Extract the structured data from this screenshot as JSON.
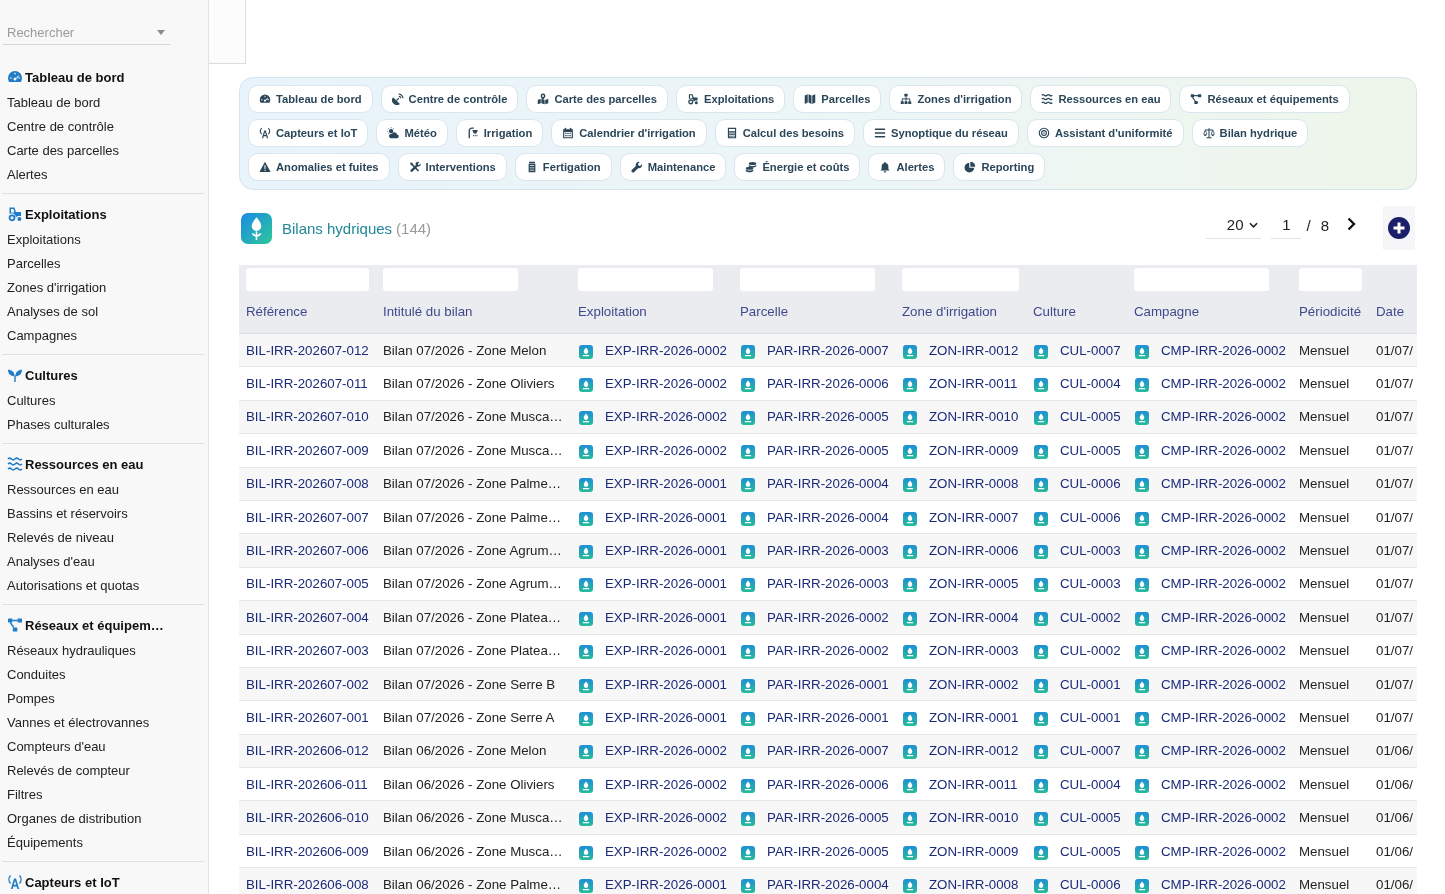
{
  "sidebar": {
    "search": {
      "placeholder": "Rechercher"
    },
    "sections": [
      {
        "title": "Tableau de bord",
        "items": [
          "Tableau de bord",
          "Centre de contrôle",
          "Carte des parcelles",
          "Alertes"
        ]
      },
      {
        "title": "Exploitations",
        "items": [
          "Exploitations",
          "Parcelles",
          "Zones d'irrigation",
          "Analyses de sol",
          "Campagnes"
        ]
      },
      {
        "title": "Cultures",
        "items": [
          "Cultures",
          "Phases culturales"
        ]
      },
      {
        "title": "Ressources en eau",
        "items": [
          "Ressources en eau",
          "Bassins et réservoirs",
          "Relevés de niveau",
          "Analyses d'eau",
          "Autorisations et quotas"
        ]
      },
      {
        "title": "Réseaux et équipem…",
        "items": [
          "Réseaux hydrauliques",
          "Conduites",
          "Pompes",
          "Vannes et électrovannes",
          "Compteurs d'eau",
          "Relevés de compteur",
          "Filtres",
          "Organes de distribution",
          "Équipements"
        ]
      },
      {
        "title": "Capteurs et IoT"
      }
    ]
  },
  "nav": {
    "rows": [
      [
        "Tableau de bord",
        "Centre de contrôle",
        "Carte des parcelles",
        "Exploitations",
        "Parcelles",
        "Zones d'irrigation",
        "Ressources en eau",
        "Réseaux et équipements"
      ],
      [
        "Capteurs et IoT",
        "Météo",
        "Irrigation",
        "Calendrier d'irrigation",
        "Calcul des besoins",
        "Synoptique du réseau",
        "Assistant d'uniformité",
        "Bilan hydrique"
      ],
      [
        "Anomalies et fuites",
        "Interventions",
        "Fertigation",
        "Maintenance",
        "Énergie et coûts",
        "Alertes",
        "Reporting"
      ]
    ]
  },
  "list": {
    "title": "Bilans hydriques",
    "count": "(144)",
    "page_size": "20",
    "page": "1",
    "page_separator": "/",
    "page_count": "8"
  },
  "table": {
    "columns": [
      {
        "label": "Référence",
        "kind": "ref",
        "filter_field": true
      },
      {
        "label": "Intitulé du bilan",
        "kind": "text",
        "filter_field": true
      },
      {
        "label": "Exploitation",
        "kind": "link",
        "filter_field": true
      },
      {
        "label": "Parcelle",
        "kind": "link",
        "filter_field": true
      },
      {
        "label": "Zone d'irrigation",
        "kind": "link",
        "filter_field": true
      },
      {
        "label": "Culture",
        "kind": "link",
        "filter_field": false
      },
      {
        "label": "Campagne",
        "kind": "link",
        "filter_field": true
      },
      {
        "label": "Périodicité",
        "kind": "text",
        "filter_field": true
      },
      {
        "label": "Date",
        "kind": "text",
        "filter_field": false
      }
    ],
    "rows": [
      [
        "BIL-IRR-202607-012",
        "Bilan 07/2026 - Zone Melon",
        "EXP-IRR-2026-0002",
        "PAR-IRR-2026-0007",
        "ZON-IRR-0012",
        "CUL-0007",
        "CMP-IRR-2026-0002",
        "Mensuel",
        "01/07/"
      ],
      [
        "BIL-IRR-202607-011",
        "Bilan 07/2026 - Zone Oliviers",
        "EXP-IRR-2026-0002",
        "PAR-IRR-2026-0006",
        "ZON-IRR-0011",
        "CUL-0004",
        "CMP-IRR-2026-0002",
        "Mensuel",
        "01/07/"
      ],
      [
        "BIL-IRR-202607-010",
        "Bilan 07/2026 - Zone Musca…",
        "EXP-IRR-2026-0002",
        "PAR-IRR-2026-0005",
        "ZON-IRR-0010",
        "CUL-0005",
        "CMP-IRR-2026-0002",
        "Mensuel",
        "01/07/"
      ],
      [
        "BIL-IRR-202607-009",
        "Bilan 07/2026 - Zone Musca…",
        "EXP-IRR-2026-0002",
        "PAR-IRR-2026-0005",
        "ZON-IRR-0009",
        "CUL-0005",
        "CMP-IRR-2026-0002",
        "Mensuel",
        "01/07/"
      ],
      [
        "BIL-IRR-202607-008",
        "Bilan 07/2026 - Zone Palme…",
        "EXP-IRR-2026-0001",
        "PAR-IRR-2026-0004",
        "ZON-IRR-0008",
        "CUL-0006",
        "CMP-IRR-2026-0002",
        "Mensuel",
        "01/07/"
      ],
      [
        "BIL-IRR-202607-007",
        "Bilan 07/2026 - Zone Palme…",
        "EXP-IRR-2026-0001",
        "PAR-IRR-2026-0004",
        "ZON-IRR-0007",
        "CUL-0006",
        "CMP-IRR-2026-0002",
        "Mensuel",
        "01/07/"
      ],
      [
        "BIL-IRR-202607-006",
        "Bilan 07/2026 - Zone Agrum…",
        "EXP-IRR-2026-0001",
        "PAR-IRR-2026-0003",
        "ZON-IRR-0006",
        "CUL-0003",
        "CMP-IRR-2026-0002",
        "Mensuel",
        "01/07/"
      ],
      [
        "BIL-IRR-202607-005",
        "Bilan 07/2026 - Zone Agrum…",
        "EXP-IRR-2026-0001",
        "PAR-IRR-2026-0003",
        "ZON-IRR-0005",
        "CUL-0003",
        "CMP-IRR-2026-0002",
        "Mensuel",
        "01/07/"
      ],
      [
        "BIL-IRR-202607-004",
        "Bilan 07/2026 - Zone Platea…",
        "EXP-IRR-2026-0001",
        "PAR-IRR-2026-0002",
        "ZON-IRR-0004",
        "CUL-0002",
        "CMP-IRR-2026-0002",
        "Mensuel",
        "01/07/"
      ],
      [
        "BIL-IRR-202607-003",
        "Bilan 07/2026 - Zone Platea…",
        "EXP-IRR-2026-0001",
        "PAR-IRR-2026-0002",
        "ZON-IRR-0003",
        "CUL-0002",
        "CMP-IRR-2026-0002",
        "Mensuel",
        "01/07/"
      ],
      [
        "BIL-IRR-202607-002",
        "Bilan 07/2026 - Zone Serre B",
        "EXP-IRR-2026-0001",
        "PAR-IRR-2026-0001",
        "ZON-IRR-0002",
        "CUL-0001",
        "CMP-IRR-2026-0002",
        "Mensuel",
        "01/07/"
      ],
      [
        "BIL-IRR-202607-001",
        "Bilan 07/2026 - Zone Serre A",
        "EXP-IRR-2026-0001",
        "PAR-IRR-2026-0001",
        "ZON-IRR-0001",
        "CUL-0001",
        "CMP-IRR-2026-0002",
        "Mensuel",
        "01/07/"
      ],
      [
        "BIL-IRR-202606-012",
        "Bilan 06/2026 - Zone Melon",
        "EXP-IRR-2026-0002",
        "PAR-IRR-2026-0007",
        "ZON-IRR-0012",
        "CUL-0007",
        "CMP-IRR-2026-0002",
        "Mensuel",
        "01/06/"
      ],
      [
        "BIL-IRR-202606-011",
        "Bilan 06/2026 - Zone Oliviers",
        "EXP-IRR-2026-0002",
        "PAR-IRR-2026-0006",
        "ZON-IRR-0011",
        "CUL-0004",
        "CMP-IRR-2026-0002",
        "Mensuel",
        "01/06/"
      ],
      [
        "BIL-IRR-202606-010",
        "Bilan 06/2026 - Zone Musca…",
        "EXP-IRR-2026-0002",
        "PAR-IRR-2026-0005",
        "ZON-IRR-0010",
        "CUL-0005",
        "CMP-IRR-2026-0002",
        "Mensuel",
        "01/06/"
      ],
      [
        "BIL-IRR-202606-009",
        "Bilan 06/2026 - Zone Musca…",
        "EXP-IRR-2026-0002",
        "PAR-IRR-2026-0005",
        "ZON-IRR-0009",
        "CUL-0005",
        "CMP-IRR-2026-0002",
        "Mensuel",
        "01/06/"
      ],
      [
        "BIL-IRR-202606-008",
        "Bilan 06/2026 - Zone Palme…",
        "EXP-IRR-2026-0001",
        "PAR-IRR-2026-0004",
        "ZON-IRR-0008",
        "CUL-0006",
        "CMP-IRR-2026-0002",
        "Mensuel",
        "01/06/"
      ]
    ]
  }
}
